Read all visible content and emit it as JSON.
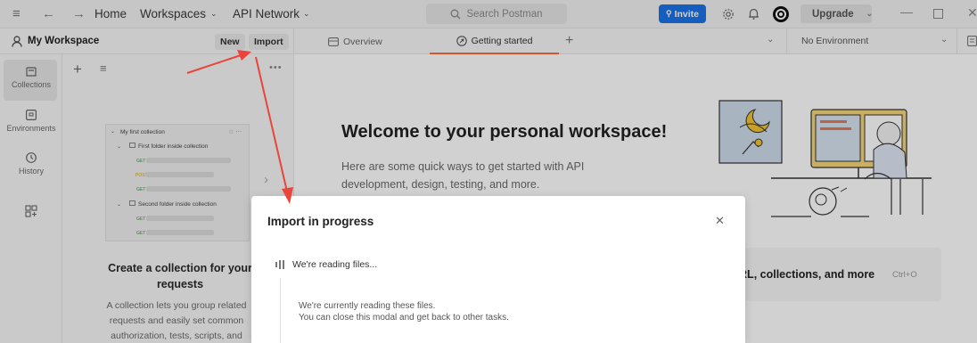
{
  "header": {
    "nav": {
      "home": "Home",
      "workspaces": "Workspaces",
      "api_network": "API Network"
    },
    "search_placeholder": "Search Postman",
    "invite_label": "Invite",
    "upgrade_label": "Upgrade"
  },
  "workspace": {
    "name": "My Workspace",
    "new_label": "New",
    "import_label": "Import"
  },
  "tabs": [
    {
      "label": "Overview"
    },
    {
      "label": "Getting started"
    }
  ],
  "environment": {
    "selected": "No Environment"
  },
  "rail": [
    {
      "label": "Collections"
    },
    {
      "label": "Environments"
    },
    {
      "label": "History"
    }
  ],
  "illustration": {
    "collection": "My first collection",
    "folder1": "First folder inside collection",
    "folder2": "Second folder inside collection",
    "methods": [
      "GET",
      "POST",
      "GET",
      "GET",
      "GET"
    ]
  },
  "sidebar_empty": {
    "title": "Create a collection for your requests",
    "line1": "A collection lets you group related",
    "line2": "requests and easily set common",
    "line3": "authorization, tests, scripts, and"
  },
  "welcome": {
    "title": "Welcome to your personal workspace!",
    "line1": "Here are some quick ways to get started with API",
    "line2": "development, design, testing, and more."
  },
  "import_card": {
    "text": "URL, collections, and more",
    "shortcut": "Ctrl+O"
  },
  "modal": {
    "title": "Import in progress",
    "step": "We're reading files...",
    "desc1": "We're currently reading these files.",
    "desc2": "You can close this modal and get back to other tasks."
  },
  "colors": {
    "accent": "#1a73e8",
    "tab_active": "#ff6c37",
    "annotation": "#e8453c"
  }
}
